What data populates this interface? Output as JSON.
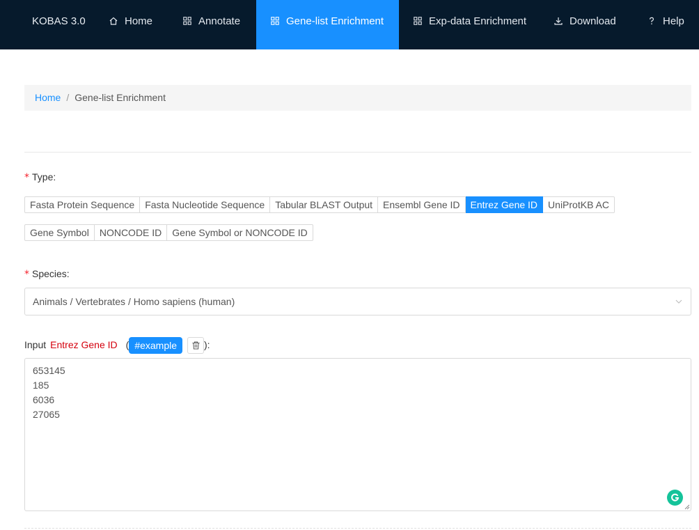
{
  "nav": {
    "brand": "KOBAS 3.0",
    "items": [
      {
        "label": "Home",
        "icon": "home-icon"
      },
      {
        "label": "Annotate",
        "icon": "grid-icon"
      },
      {
        "label": "Gene-list Enrichment",
        "icon": "grid-icon",
        "active": true
      },
      {
        "label": "Exp-data Enrichment",
        "icon": "grid-icon"
      },
      {
        "label": "Download",
        "icon": "download-icon"
      },
      {
        "label": "Help",
        "icon": "question-icon"
      }
    ]
  },
  "breadcrumb": {
    "home": "Home",
    "separator": "/",
    "current": "Gene-list Enrichment"
  },
  "form": {
    "required_mark": "*",
    "type_label": "Type:",
    "type_options": [
      "Fasta Protein Sequence",
      "Fasta Nucleotide Sequence",
      "Tabular BLAST Output",
      "Ensembl Gene ID",
      "Entrez Gene ID",
      "UniProtKB AC",
      "Gene Symbol",
      "NONCODE ID",
      "Gene Symbol or NONCODE ID"
    ],
    "selected_type": "Entrez Gene ID",
    "species_label": "Species:",
    "species_value": "Animals / Vertebrates / Homo sapiens (human)",
    "input_label": "Input",
    "input_type": "Entrez Gene ID",
    "open_paren": "(",
    "close_paren": "):",
    "example_button": "#example",
    "input_text": "653145\n185\n6036\n27065"
  },
  "colors": {
    "nav_bg": "#061a2c",
    "accent": "#1890ff",
    "required": "#f5222d",
    "input_type_text": "#d4000d"
  }
}
